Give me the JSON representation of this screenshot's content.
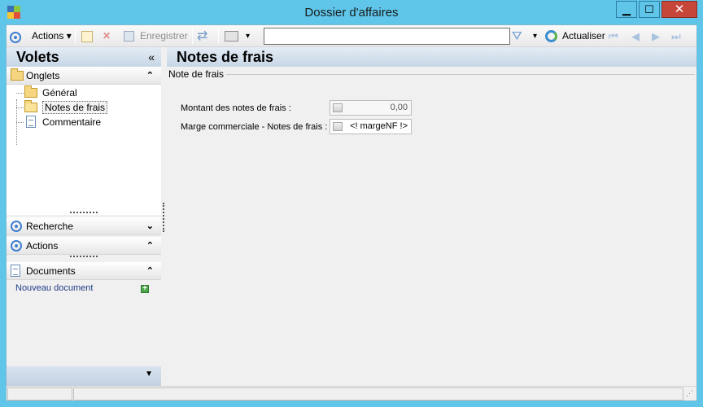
{
  "window": {
    "title": "Dossier d'affaires",
    "minimize": "▁",
    "maximize": "☐",
    "close": "✕"
  },
  "toolbar": {
    "actions_label": "Actions",
    "save_label": "Enregistrer",
    "refresh_label": "Actualiser",
    "search_value": ""
  },
  "left": {
    "title": "Volets",
    "collapse_glyph": "«",
    "sections": {
      "onglets": "Onglets",
      "recherche": "Recherche",
      "actions": "Actions",
      "documents": "Documents"
    },
    "tree": [
      "Général",
      "Notes de frais",
      "Commentaire"
    ],
    "new_document": "Nouveau document"
  },
  "main": {
    "title": "Notes de frais",
    "group": "Note de frais",
    "fields": {
      "montant_label": "Montant des notes de frais :",
      "montant_value": "0,00",
      "marge_label": "Marge commerciale - Notes de frais :",
      "marge_value": "<! margeNF !>"
    }
  },
  "colors": {
    "titlebar": "#5fc6ea",
    "close_button": "#c7463a",
    "panel_header": "#c8d6e6"
  },
  "icons": [
    "app-icon",
    "circle-icon",
    "new-icon",
    "delete-icon",
    "save-icon",
    "refresh-icon",
    "print-icon",
    "filter-icon",
    "first-icon",
    "prev-icon",
    "next-icon",
    "last-icon",
    "folder-icon",
    "document-icon",
    "add-icon"
  ]
}
